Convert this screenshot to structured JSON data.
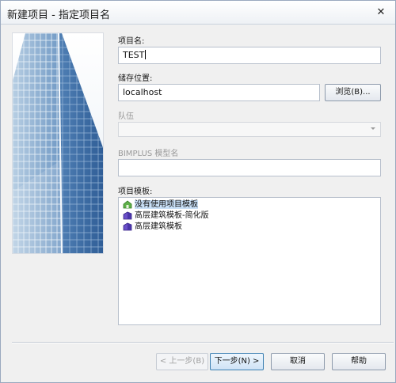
{
  "window": {
    "title": "新建项目 - 指定项目名",
    "close_glyph": "✕"
  },
  "form": {
    "project_name_label": "项目名:",
    "project_name_value": "TEST",
    "storage_label": "储存位置:",
    "storage_value": "localhost",
    "browse_label": "浏览(B)...",
    "team_label": "队伍",
    "team_value": "",
    "bimplus_label": "BIMPLUS 模型名",
    "bimplus_value": "",
    "template_label": "项目模板:"
  },
  "templates": [
    {
      "label": "没有使用项目模板",
      "icon": "green-house-icon",
      "selected": true
    },
    {
      "label": "高层建筑模板-简化版",
      "icon": "purple-building-icon",
      "selected": false
    },
    {
      "label": "高层建筑模板",
      "icon": "purple-building-icon",
      "selected": false
    }
  ],
  "buttons": {
    "back_label": "< 上一步(B)",
    "next_label": "下一步(N) >",
    "cancel_label": "取消",
    "help_label": "帮助"
  },
  "colors": {
    "accent": "#3c7fb1",
    "selection": "#c9e0f7"
  }
}
